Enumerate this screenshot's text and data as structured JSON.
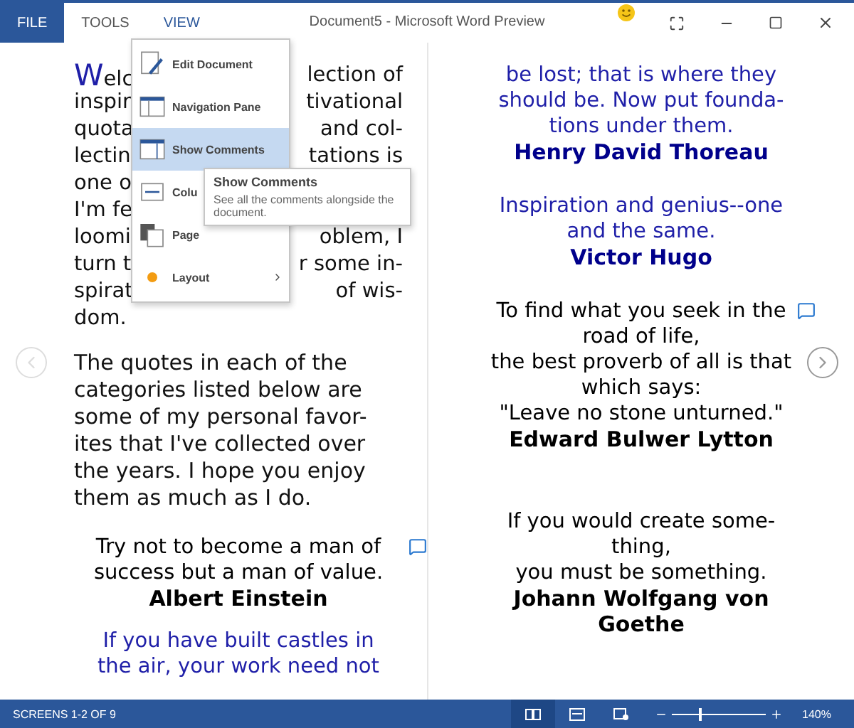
{
  "ribbon": {
    "tabs": [
      {
        "label": "FILE",
        "kind": "file",
        "selected": false
      },
      {
        "label": "TOOLS",
        "kind": "tab",
        "selected": false
      },
      {
        "label": "VIEW",
        "kind": "tab",
        "selected": true
      }
    ],
    "title": "Document5 - Microsoft Word Preview"
  },
  "view_menu": {
    "items": [
      {
        "label": "Edit Document",
        "kind": "edit",
        "selected": false,
        "submenu": false
      },
      {
        "label": "Navigation Pane",
        "kind": "nav",
        "selected": false,
        "submenu": false
      },
      {
        "label": "Show Comments",
        "kind": "comments",
        "selected": true,
        "submenu": false
      },
      {
        "label": "Colu",
        "kind": "columns",
        "selected": false,
        "submenu": false
      },
      {
        "label": "Page",
        "kind": "pages",
        "selected": false,
        "submenu": false
      },
      {
        "label": "Layout",
        "kind": "layout",
        "selected": false,
        "submenu": true
      }
    ]
  },
  "tooltip": {
    "title": "Show Comments",
    "text": "See all the comments alongside the document."
  },
  "left_page": {
    "intro_lines": [
      {
        "left": "Welc",
        "right": "lection of"
      },
      {
        "left": "inspir",
        "right": "tivational"
      },
      {
        "left": "quota",
        "right": "and col-"
      },
      {
        "left": "lectin",
        "right": "tations is"
      },
      {
        "left": "one o"
      },
      {
        "left": "I'm fe"
      },
      {
        "left": "loomi",
        "right": "oblem, I"
      },
      {
        "left": "turn t",
        "right": "r some in-"
      },
      {
        "left": "spirat",
        "right": "of wis-"
      },
      {
        "left": "dom."
      }
    ],
    "paragraph": "The quotes in each of the\ncategories listed below are\nsome of my personal favor-\nites that I've collected over\nthe years. I hope you enjoy\nthem as much as I do.",
    "quotes": [
      {
        "text": "Try not to become a man of\nsuccess but a man of value.",
        "author": "Albert Einstein",
        "color": "#000000",
        "comment": true
      },
      {
        "text": "If you have built castles in\nthe air, your work need not",
        "color": "#1f1fa8",
        "comment": false
      }
    ]
  },
  "right_page": {
    "quotes": [
      {
        "text": "be lost; that is where they\nshould be. Now put founda-\ntions under them.",
        "author": "Henry David Thoreau",
        "color": "#1f1fa8",
        "comment": false
      },
      {
        "text": "Inspiration and genius--one\nand the same.",
        "author": "Victor Hugo",
        "color": "#1f1fa8",
        "comment": false
      },
      {
        "text": "To find what you seek in the\nroad of life,\nthe best proverb of all is that\nwhich says:\n\"Leave no stone unturned.\"",
        "author": "Edward Bulwer Lytton",
        "color": "#000000",
        "comment": true
      },
      {
        "text": "If you would create some-\nthing,\nyou must be something.",
        "author": "Johann Wolfgang von\nGoethe",
        "color": "#000000",
        "comment": false
      }
    ]
  },
  "status_bar": {
    "screens": "SCREENS 1-2 OF 9",
    "views": [
      {
        "kind": "read",
        "selected": true
      },
      {
        "kind": "print",
        "selected": false
      },
      {
        "kind": "web",
        "selected": false
      }
    ],
    "zoom": {
      "level": 0.3,
      "reading": "140%"
    }
  }
}
